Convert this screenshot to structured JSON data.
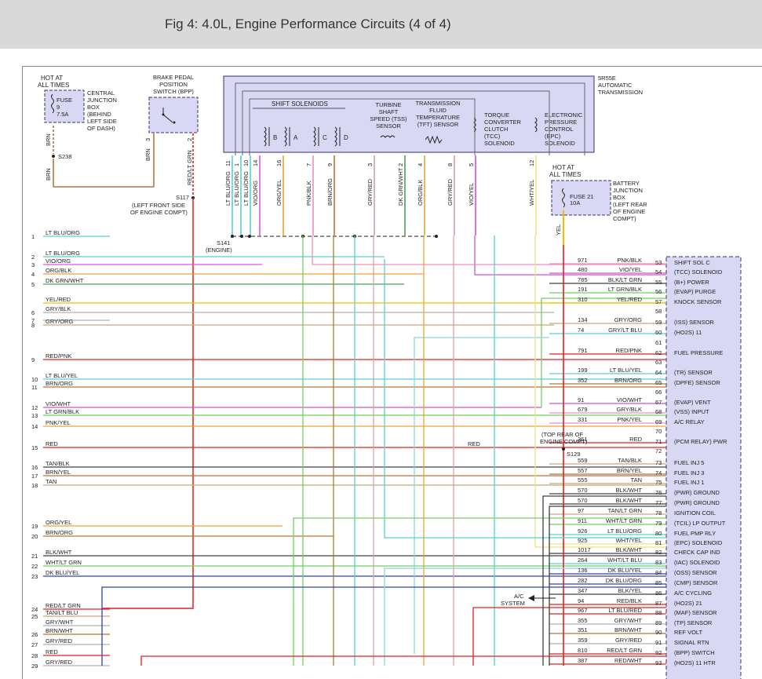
{
  "header": {
    "title": "Fig 4: 4.0L, Engine Performance Circuits (4 of 4)"
  },
  "components": {
    "hot_all_times_1": [
      "HOT AT",
      "ALL TIMES"
    ],
    "fuse9": [
      "FUSE",
      "9",
      "7.5A"
    ],
    "central_junction_box": [
      "CENTRAL",
      "JUNCTION",
      "BOX",
      "(BEHIND",
      "LEFT SIDE",
      "OF DASH)"
    ],
    "bpp_switch": [
      "BRAKE PEDAL",
      "POSITION",
      "SWITCH (BPP)"
    ],
    "transmission": [
      "5R55E",
      "AUTOMATIC",
      "TRANSMISSION"
    ],
    "shift_solenoids": "SHIFT SOLENOIDS",
    "solenoid_letters": [
      "B",
      "A",
      "C",
      "D"
    ],
    "tss_sensor": [
      "TURBINE",
      "SHAFT",
      "SPEED (TSS)",
      "SENSOR"
    ],
    "tft_sensor": [
      "TRANSMISSION",
      "FLUID",
      "TEMPERATURE",
      "(TFT) SENSOR"
    ],
    "tcc_solenoid": [
      "TORQUE",
      "CONVERTER",
      "CLUTCH",
      "(TCC)",
      "SOLENOID"
    ],
    "epc_solenoid": [
      "ELECTRONIC",
      "PRESSURE",
      "CONTROL",
      "(EPC)",
      "SOLENOID"
    ],
    "hot_all_times_2": [
      "HOT AT",
      "ALL TIMES"
    ],
    "fuse21": [
      "FUSE 21",
      "10A"
    ],
    "battery_junction_box": [
      "BATTERY",
      "JUNCTION",
      "BOX",
      "(LEFT REAR",
      "OF ENGINE",
      "COMPT)"
    ],
    "s238": "S238",
    "s117": [
      "S117",
      "(LEFT FRONT SIDE",
      "OF ENGINE COMPT)"
    ],
    "s141": [
      "S141",
      "(ENGINE)"
    ],
    "s129": [
      "(TOP REAR OF",
      "ENGINE COMPT)",
      "S129"
    ],
    "ac_system": [
      "A/C",
      "SYSTEM"
    ],
    "wire_brn": "BRN",
    "wire_yel": "YEL",
    "red_mid": "RED"
  },
  "connector_pins": [
    {
      "label": "LT BLU/ORG",
      "pin": "11"
    },
    {
      "label": "LT BLU/ORG",
      "pin": "1"
    },
    {
      "label": "LT BLU/ORG",
      "pin": "10"
    },
    {
      "label": "VIO/ORG",
      "pin": "14"
    },
    {
      "label": "ORG/YEL",
      "pin": "16"
    },
    {
      "label": "PNK/BLK",
      "pin": "7"
    },
    {
      "label": "BRN/ORG",
      "pin": "9"
    },
    {
      "label": "GRY/RED",
      "pin": "3"
    },
    {
      "label": "DK GRN/WHT",
      "pin": "2"
    },
    {
      "label": "ORG/BLK",
      "pin": "4"
    },
    {
      "label": "GRY/RED",
      "pin": "8"
    },
    {
      "label": "VIO/YEL",
      "pin": "5"
    },
    {
      "label": "WHT/YEL",
      "pin": "12"
    }
  ],
  "bpp_pins": [
    {
      "label": "BRN",
      "pin": "3"
    },
    {
      "label": "RED/LT GRN",
      "pin": "2"
    }
  ],
  "left_rows": [
    {
      "n": "1",
      "label": "LT BLU/ORG"
    },
    {
      "n": "2",
      "label": "LT BLU/ORG"
    },
    {
      "n": "3",
      "label": "VIO/ORG"
    },
    {
      "n": "4",
      "label": "ORG/BLK"
    },
    {
      "n": "5",
      "label": "DK GRN/WHT"
    },
    {
      "n": "",
      "label": "YEL/RED"
    },
    {
      "n": "6",
      "label": "GRY/BLK"
    },
    {
      "n": "7",
      "label": ""
    },
    {
      "n": "8",
      "label": "GRY/ORG"
    },
    {
      "n": "9",
      "label": "RED/PNK"
    },
    {
      "n": "10",
      "label": "LT BLU/YEL"
    },
    {
      "n": "11",
      "label": "BRN/ORG"
    },
    {
      "n": "12",
      "label": "VIO/WHT"
    },
    {
      "n": "13",
      "label": "LT GRN/BLK"
    },
    {
      "n": "14",
      "label": "PNK/YEL"
    },
    {
      "n": "15",
      "label": "RED"
    },
    {
      "n": "16",
      "label": "TAN/BLK"
    },
    {
      "n": "17",
      "label": "BRN/YEL"
    },
    {
      "n": "18",
      "label": "TAN"
    },
    {
      "n": "19",
      "label": "ORG/YEL"
    },
    {
      "n": "20",
      "label": "BRN/ORG"
    },
    {
      "n": "21",
      "label": "BLK/WHT"
    },
    {
      "n": "22",
      "label": "WHT/LT GRN"
    },
    {
      "n": "23",
      "label": "DK BLU/YEL"
    },
    {
      "n": "24",
      "label": "RED/LT GRN"
    },
    {
      "n": "25",
      "label": "TAN/LT BLU"
    },
    {
      "n": "",
      "label": "GRY/WHT"
    },
    {
      "n": "26",
      "label": "BRN/WHT"
    },
    {
      "n": "27",
      "label": "GRY/RED"
    },
    {
      "n": "28",
      "label": "RED"
    },
    {
      "n": "29",
      "label": "GRY/RED"
    }
  ],
  "pcm_rows": [
    {
      "circuit": "971",
      "wire": "PNK/BLK",
      "pin": "53",
      "desc": "SHIFT SOL C"
    },
    {
      "circuit": "480",
      "wire": "VIO/YEL",
      "pin": "54",
      "desc": "(TCC) SOLENOID"
    },
    {
      "circuit": "785",
      "wire": "BLK/LT GRN",
      "pin": "55",
      "desc": "(B+) POWER"
    },
    {
      "circuit": "191",
      "wire": "LT GRN/BLK",
      "pin": "56",
      "desc": "(EVAP) PURGE"
    },
    {
      "circuit": "310",
      "wire": "YEL/RED",
      "pin": "57",
      "desc": "KNOCK SENSOR"
    },
    {
      "circuit": "",
      "wire": "",
      "pin": "58",
      "desc": ""
    },
    {
      "circuit": "134",
      "wire": "GRY/ORG",
      "pin": "59",
      "desc": "(ISS) SENSOR"
    },
    {
      "circuit": "74",
      "wire": "GRY/LT BLU",
      "pin": "60",
      "desc": "(HO2S) 11"
    },
    {
      "circuit": "",
      "wire": "",
      "pin": "61",
      "desc": ""
    },
    {
      "circuit": "791",
      "wire": "RED/PNK",
      "pin": "62",
      "desc": "FUEL PRESSURE"
    },
    {
      "circuit": "",
      "wire": "",
      "pin": "63",
      "desc": ""
    },
    {
      "circuit": "199",
      "wire": "LT BLU/YEL",
      "pin": "64",
      "desc": "(TR) SENSOR"
    },
    {
      "circuit": "352",
      "wire": "BRN/ORG",
      "pin": "65",
      "desc": "(DPFE) SENSOR"
    },
    {
      "circuit": "",
      "wire": "",
      "pin": "66",
      "desc": ""
    },
    {
      "circuit": "91",
      "wire": "VIO/WHT",
      "pin": "67",
      "desc": "(EVAP) VENT"
    },
    {
      "circuit": "679",
      "wire": "GRY/BLK",
      "pin": "68",
      "desc": "(VSS) INPUT"
    },
    {
      "circuit": "331",
      "wire": "PNK/YEL",
      "pin": "69",
      "desc": "A/C RELAY"
    },
    {
      "circuit": "",
      "wire": "",
      "pin": "70",
      "desc": ""
    },
    {
      "circuit": "361",
      "wire": "RED",
      "pin": "71",
      "desc": "(PCM RELAY) PWR"
    },
    {
      "circuit": "",
      "wire": "",
      "pin": "72",
      "desc": ""
    },
    {
      "circuit": "559",
      "wire": "TAN/BLK",
      "pin": "73",
      "desc": "FUEL INJ 5"
    },
    {
      "circuit": "557",
      "wire": "BRN/YEL",
      "pin": "74",
      "desc": "FUEL INJ 3"
    },
    {
      "circuit": "555",
      "wire": "TAN",
      "pin": "75",
      "desc": "FUEL INJ 1"
    },
    {
      "circuit": "570",
      "wire": "BLK/WHT",
      "pin": "76",
      "desc": "(PWR) GROUND"
    },
    {
      "circuit": "570",
      "wire": "BLK/WHT",
      "pin": "77",
      "desc": "(PWR) GROUND"
    },
    {
      "circuit": "97",
      "wire": "TAN/LT GRN",
      "pin": "78",
      "desc": "IGNITION COIL"
    },
    {
      "circuit": "911",
      "wire": "WHT/LT GRN",
      "pin": "79",
      "desc": "(TCIL) LP OUTPUT"
    },
    {
      "circuit": "926",
      "wire": "LT BLU/ORG",
      "pin": "80",
      "desc": "FUEL PMP RLY"
    },
    {
      "circuit": "925",
      "wire": "WHT/YEL",
      "pin": "81",
      "desc": "(EPC) SOLENOID"
    },
    {
      "circuit": "1017",
      "wire": "BLK/WHT",
      "pin": "82",
      "desc": "CHECK CAP IND"
    },
    {
      "circuit": "264",
      "wire": "WHT/LT BLU",
      "pin": "83",
      "desc": "(IAC) SOLENOID"
    },
    {
      "circuit": "136",
      "wire": "DK BLU/YEL",
      "pin": "84",
      "desc": "(OSS) SENSOR"
    },
    {
      "circuit": "282",
      "wire": "DK BLU/ORG",
      "pin": "85",
      "desc": "(CMP) SENSOR"
    },
    {
      "circuit": "347",
      "wire": "BLK/YEL",
      "pin": "86",
      "desc": "A/C CYCLING"
    },
    {
      "circuit": "94",
      "wire": "RED/BLK",
      "pin": "87",
      "desc": "(HO2S) 21"
    },
    {
      "circuit": "967",
      "wire": "LT BLU/RED",
      "pin": "88",
      "desc": "(MAF) SENSOR"
    },
    {
      "circuit": "355",
      "wire": "GRY/WHT",
      "pin": "89",
      "desc": "(TP) SENSOR"
    },
    {
      "circuit": "351",
      "wire": "BRN/WHT",
      "pin": "90",
      "desc": "REF VOLT"
    },
    {
      "circuit": "359",
      "wire": "GRY/RED",
      "pin": "91",
      "desc": "SIGNAL RTN"
    },
    {
      "circuit": "810",
      "wire": "RED/LT GRN",
      "pin": "92",
      "desc": "(BPP) SWITCH"
    },
    {
      "circuit": "387",
      "wire": "RED/WHT",
      "pin": "93",
      "desc": "(HO2S) 11 HTR"
    }
  ],
  "colors": {
    "component_fill": "#d8d8f4",
    "component_stroke": "#333366",
    "lt_blu_org": "#56d0d0",
    "vio_org": "#e055e0",
    "org": "#f0a030",
    "pnk": "#f08cc0",
    "brn": "#b07838",
    "gry": "#b0b0b0",
    "dk_grn": "#4aa050",
    "yel": "#f0c000",
    "red": "#e02020",
    "lt_grn": "#70d060",
    "tan": "#c8a878",
    "blk": "#404040",
    "dk_blu": "#3040b0",
    "vio": "#d050d0"
  }
}
